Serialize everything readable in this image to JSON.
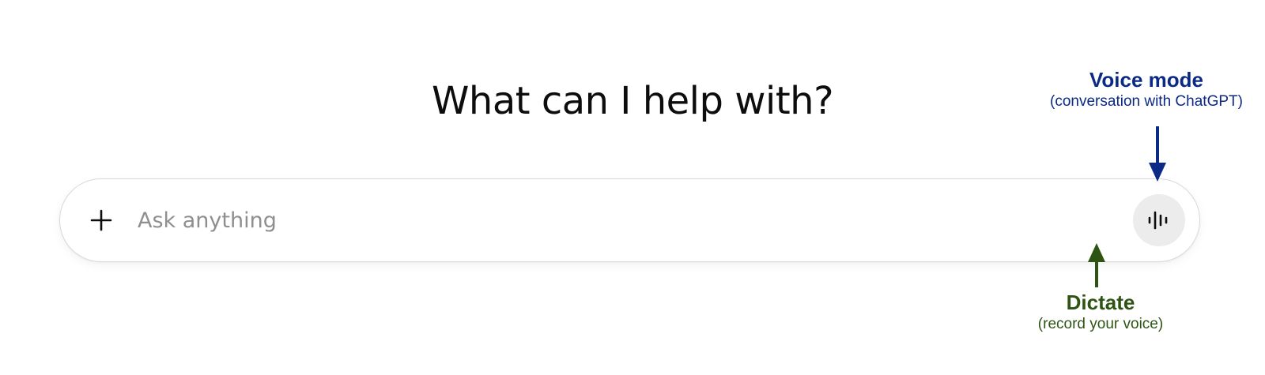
{
  "heading": "What can I help with?",
  "composer": {
    "placeholder": "Ask anything",
    "value": "",
    "plus_icon": "plus-icon",
    "mic_icon": "microphone-icon",
    "voice_icon": "voice-waveform-icon"
  },
  "annotations": {
    "voice_mode": {
      "title": "Voice mode",
      "subtitle": "(conversation with ChatGPT)",
      "color": "#0b2a85"
    },
    "dictate": {
      "title": "Dictate",
      "subtitle": "(record your voice)",
      "color": "#2e5414"
    }
  },
  "colors": {
    "voice_button_bg": "#ececec",
    "placeholder": "#8f8f8f",
    "border": "#d9d9d9"
  }
}
